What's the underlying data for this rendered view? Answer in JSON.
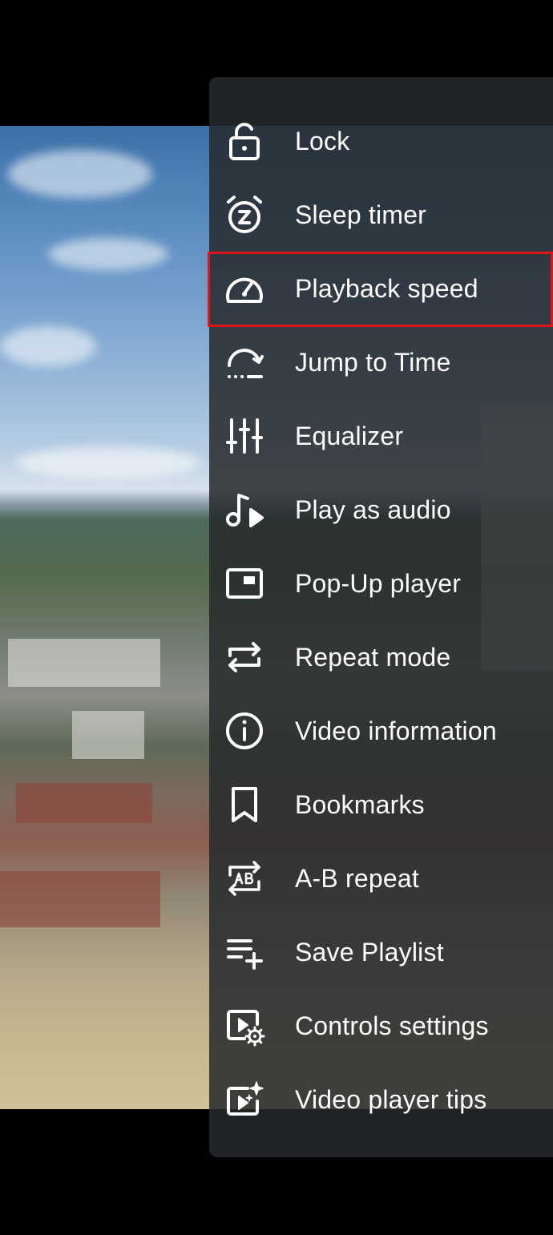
{
  "menu": {
    "items": [
      {
        "label": "Lock",
        "icon": "lock-icon"
      },
      {
        "label": "Sleep timer",
        "icon": "sleep-timer-icon"
      },
      {
        "label": "Playback speed",
        "icon": "speedometer-icon",
        "highlighted": true
      },
      {
        "label": "Jump to Time",
        "icon": "jump-to-time-icon"
      },
      {
        "label": "Equalizer",
        "icon": "equalizer-icon"
      },
      {
        "label": "Play as audio",
        "icon": "play-as-audio-icon"
      },
      {
        "label": "Pop-Up player",
        "icon": "popup-player-icon"
      },
      {
        "label": "Repeat mode",
        "icon": "repeat-icon"
      },
      {
        "label": "Video information",
        "icon": "info-icon"
      },
      {
        "label": "Bookmarks",
        "icon": "bookmark-icon"
      },
      {
        "label": "A-B repeat",
        "icon": "ab-repeat-icon"
      },
      {
        "label": "Save Playlist",
        "icon": "playlist-add-icon"
      },
      {
        "label": "Controls settings",
        "icon": "controls-settings-icon"
      },
      {
        "label": "Video player tips",
        "icon": "tips-icon"
      }
    ]
  },
  "colors": {
    "panel": "#262a2c",
    "highlight": "#e0151c",
    "text": "#ffffff"
  }
}
